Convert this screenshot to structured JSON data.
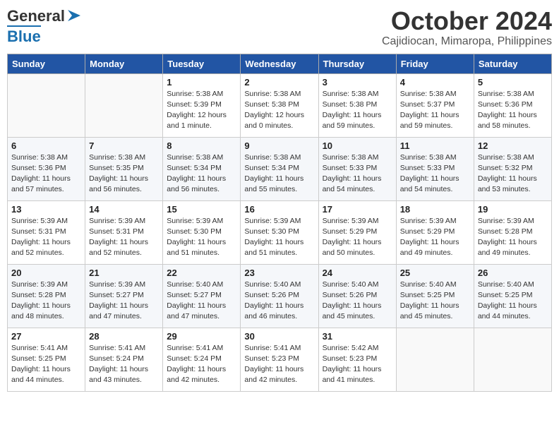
{
  "header": {
    "logo_line1": "General",
    "logo_line2": "Blue",
    "month": "October 2024",
    "location": "Cajidiocan, Mimaropa, Philippines"
  },
  "weekdays": [
    "Sunday",
    "Monday",
    "Tuesday",
    "Wednesday",
    "Thursday",
    "Friday",
    "Saturday"
  ],
  "weeks": [
    [
      {
        "day": "",
        "info": ""
      },
      {
        "day": "",
        "info": ""
      },
      {
        "day": "1",
        "info": "Sunrise: 5:38 AM\nSunset: 5:39 PM\nDaylight: 12 hours\nand 1 minute."
      },
      {
        "day": "2",
        "info": "Sunrise: 5:38 AM\nSunset: 5:38 PM\nDaylight: 12 hours\nand 0 minutes."
      },
      {
        "day": "3",
        "info": "Sunrise: 5:38 AM\nSunset: 5:38 PM\nDaylight: 11 hours\nand 59 minutes."
      },
      {
        "day": "4",
        "info": "Sunrise: 5:38 AM\nSunset: 5:37 PM\nDaylight: 11 hours\nand 59 minutes."
      },
      {
        "day": "5",
        "info": "Sunrise: 5:38 AM\nSunset: 5:36 PM\nDaylight: 11 hours\nand 58 minutes."
      }
    ],
    [
      {
        "day": "6",
        "info": "Sunrise: 5:38 AM\nSunset: 5:36 PM\nDaylight: 11 hours\nand 57 minutes."
      },
      {
        "day": "7",
        "info": "Sunrise: 5:38 AM\nSunset: 5:35 PM\nDaylight: 11 hours\nand 56 minutes."
      },
      {
        "day": "8",
        "info": "Sunrise: 5:38 AM\nSunset: 5:34 PM\nDaylight: 11 hours\nand 56 minutes."
      },
      {
        "day": "9",
        "info": "Sunrise: 5:38 AM\nSunset: 5:34 PM\nDaylight: 11 hours\nand 55 minutes."
      },
      {
        "day": "10",
        "info": "Sunrise: 5:38 AM\nSunset: 5:33 PM\nDaylight: 11 hours\nand 54 minutes."
      },
      {
        "day": "11",
        "info": "Sunrise: 5:38 AM\nSunset: 5:33 PM\nDaylight: 11 hours\nand 54 minutes."
      },
      {
        "day": "12",
        "info": "Sunrise: 5:38 AM\nSunset: 5:32 PM\nDaylight: 11 hours\nand 53 minutes."
      }
    ],
    [
      {
        "day": "13",
        "info": "Sunrise: 5:39 AM\nSunset: 5:31 PM\nDaylight: 11 hours\nand 52 minutes."
      },
      {
        "day": "14",
        "info": "Sunrise: 5:39 AM\nSunset: 5:31 PM\nDaylight: 11 hours\nand 52 minutes."
      },
      {
        "day": "15",
        "info": "Sunrise: 5:39 AM\nSunset: 5:30 PM\nDaylight: 11 hours\nand 51 minutes."
      },
      {
        "day": "16",
        "info": "Sunrise: 5:39 AM\nSunset: 5:30 PM\nDaylight: 11 hours\nand 51 minutes."
      },
      {
        "day": "17",
        "info": "Sunrise: 5:39 AM\nSunset: 5:29 PM\nDaylight: 11 hours\nand 50 minutes."
      },
      {
        "day": "18",
        "info": "Sunrise: 5:39 AM\nSunset: 5:29 PM\nDaylight: 11 hours\nand 49 minutes."
      },
      {
        "day": "19",
        "info": "Sunrise: 5:39 AM\nSunset: 5:28 PM\nDaylight: 11 hours\nand 49 minutes."
      }
    ],
    [
      {
        "day": "20",
        "info": "Sunrise: 5:39 AM\nSunset: 5:28 PM\nDaylight: 11 hours\nand 48 minutes."
      },
      {
        "day": "21",
        "info": "Sunrise: 5:39 AM\nSunset: 5:27 PM\nDaylight: 11 hours\nand 47 minutes."
      },
      {
        "day": "22",
        "info": "Sunrise: 5:40 AM\nSunset: 5:27 PM\nDaylight: 11 hours\nand 47 minutes."
      },
      {
        "day": "23",
        "info": "Sunrise: 5:40 AM\nSunset: 5:26 PM\nDaylight: 11 hours\nand 46 minutes."
      },
      {
        "day": "24",
        "info": "Sunrise: 5:40 AM\nSunset: 5:26 PM\nDaylight: 11 hours\nand 45 minutes."
      },
      {
        "day": "25",
        "info": "Sunrise: 5:40 AM\nSunset: 5:25 PM\nDaylight: 11 hours\nand 45 minutes."
      },
      {
        "day": "26",
        "info": "Sunrise: 5:40 AM\nSunset: 5:25 PM\nDaylight: 11 hours\nand 44 minutes."
      }
    ],
    [
      {
        "day": "27",
        "info": "Sunrise: 5:41 AM\nSunset: 5:25 PM\nDaylight: 11 hours\nand 44 minutes."
      },
      {
        "day": "28",
        "info": "Sunrise: 5:41 AM\nSunset: 5:24 PM\nDaylight: 11 hours\nand 43 minutes."
      },
      {
        "day": "29",
        "info": "Sunrise: 5:41 AM\nSunset: 5:24 PM\nDaylight: 11 hours\nand 42 minutes."
      },
      {
        "day": "30",
        "info": "Sunrise: 5:41 AM\nSunset: 5:23 PM\nDaylight: 11 hours\nand 42 minutes."
      },
      {
        "day": "31",
        "info": "Sunrise: 5:42 AM\nSunset: 5:23 PM\nDaylight: 11 hours\nand 41 minutes."
      },
      {
        "day": "",
        "info": ""
      },
      {
        "day": "",
        "info": ""
      }
    ]
  ]
}
